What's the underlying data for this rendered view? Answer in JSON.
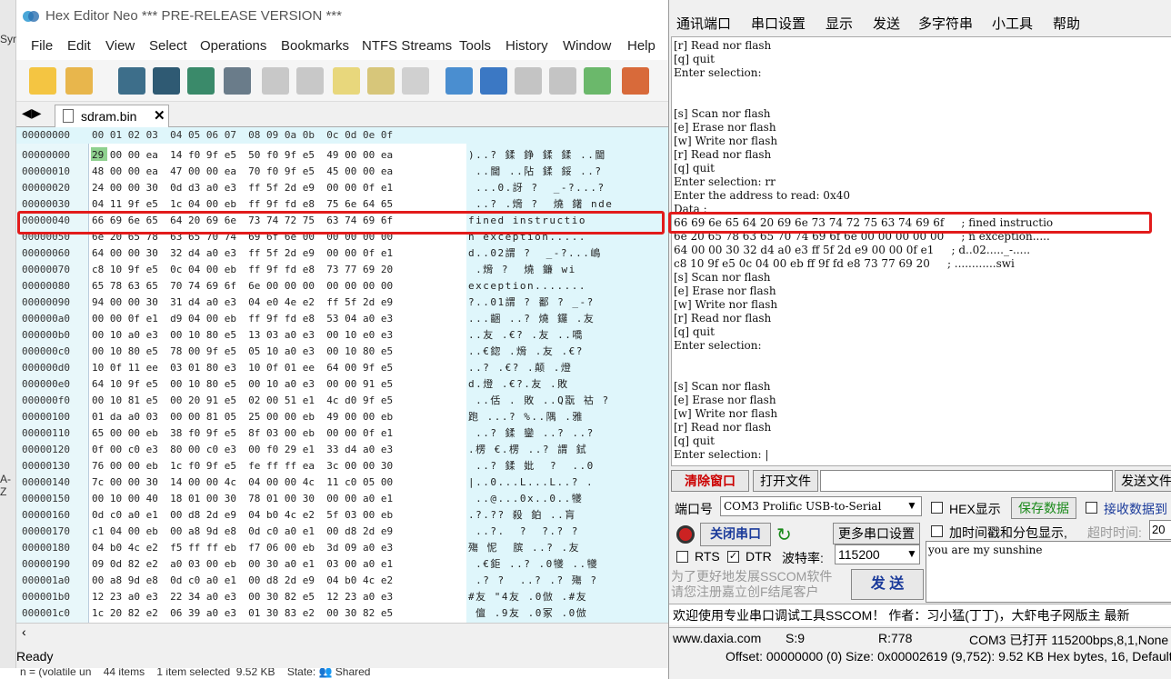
{
  "hex_editor": {
    "title": "Hex Editor Neo *** PRE-RELEASE VERSION ***",
    "menu": [
      "File",
      "Edit",
      "View",
      "Select",
      "Operations",
      "Bookmarks",
      "NTFS Streams",
      "Tools",
      "History",
      "Window",
      "Help"
    ],
    "tab": "sdram.bin",
    "header_offset": "00000000",
    "header_cols": "00 01 02 03  04 05 06 07  08 09 0a 0b  0c 0d 0e 0f",
    "rows": [
      {
        "off": "00000000",
        "hex": "29 00 00 ea  14 f0 9f e5  50 f0 9f e5  49 00 00 ea",
        "asc": ")..? 鍒 錚 鍒 鍒 ..閫"
      },
      {
        "off": "00000010",
        "hex": "48 00 00 ea  47 00 00 ea  70 f0 9f e5  45 00 00 ea",
        "asc": " ..閫 ..阽 鍒 鋖 ..?"
      },
      {
        "off": "00000020",
        "hex": "24 00 00 30  0d d3 a0 e3  ff 5f 2d e9  00 00 0f e1",
        "asc": " ...0.訝 ?  _-?...?"
      },
      {
        "off": "00000030",
        "hex": "04 11 9f e5  1c 04 00 eb  ff 9f fd e8  75 6e 64 65",
        "asc": " ..? .熁 ?  燒 鐯 nde"
      },
      {
        "off": "00000040",
        "hex": "66 69 6e 65  64 20 69 6e  73 74 72 75  63 74 69 6f",
        "asc": "fined instructio"
      },
      {
        "off": "00000050",
        "hex": "6e 20 65 78  63 65 70 74  69 6f 6e 00  00 00 00 00",
        "asc": "n exception....."
      },
      {
        "off": "00000060",
        "hex": "64 00 00 30  32 d4 a0 e3  ff 5f 2d e9  00 00 0f e1",
        "asc": "d..02謂 ?  _-?...嶋"
      },
      {
        "off": "00000070",
        "hex": "c8 10 9f e5  0c 04 00 eb  ff 9f fd e8  73 77 69 20",
        "asc": " .熁 ?  燒 鐮 wi"
      },
      {
        "off": "00000080",
        "hex": "65 78 63 65  70 74 69 6f  6e 00 00 00  00 00 00 00",
        "asc": "exception......."
      },
      {
        "off": "00000090",
        "hex": "94 00 00 30  31 d4 a0 e3  04 e0 4e e2  ff 5f 2d e9",
        "asc": "?..01謂 ? 鄱 ? _-?"
      },
      {
        "off": "000000a0",
        "hex": "00 00 0f e1  d9 04 00 eb  ff 9f fd e8  53 04 a0 e3",
        "asc": "...齫 ..? 燒 鑼 .友"
      },
      {
        "off": "000000b0",
        "hex": "00 10 a0 e3  00 10 80 e5  13 03 a0 e3  00 10 e0 e3",
        "asc": "..友 .€? .友 ..嘺"
      },
      {
        "off": "000000c0",
        "hex": "00 10 80 e5  78 00 9f e5  05 10 a0 e3  00 10 80 e5",
        "asc": "..€鍃 .熁 .友 .€?"
      },
      {
        "off": "000000d0",
        "hex": "10 0f 11 ee  03 01 80 e3  10 0f 01 ee  64 00 9f e5",
        "asc": "..? .€? .颠 .燈"
      },
      {
        "off": "000000e0",
        "hex": "64 10 9f e5  00 10 80 e5  00 10 a0 e3  00 00 91 e5",
        "asc": "d.燈 .€?.友 .敗"
      },
      {
        "off": "000000f0",
        "hex": "00 10 81 e5  00 20 91 e5  02 00 51 e1  4c d0 9f e5",
        "asc": " ..佸 . 敗 ..Q翫 祜 ?"
      },
      {
        "off": "00000100",
        "hex": "01 da a0 03  00 00 81 05  25 00 00 eb  49 00 00 eb",
        "asc": "跑 ...? %..隅 .雅"
      },
      {
        "off": "00000110",
        "hex": "65 00 00 eb  38 f0 9f e5  8f 03 00 eb  00 00 0f e1",
        "asc": " ..? 鍒 鑾 ..? ..?"
      },
      {
        "off": "00000120",
        "hex": "0f 00 c0 e3  80 00 c0 e3  00 f0 29 e1  33 d4 a0 e3",
        "asc": ".楞 €.楞 ..? 謂 鉽"
      },
      {
        "off": "00000130",
        "hex": "76 00 00 eb  1c f0 9f e5  fe ff ff ea  3c 00 00 30",
        "asc": " ..? 鍒 妣  ?  ..0"
      },
      {
        "off": "00000140",
        "hex": "7c 00 00 30  14 00 00 4c  04 00 00 4c  11 c0 05 00",
        "asc": "|..0...L...L..? ."
      },
      {
        "off": "00000150",
        "hex": "00 10 00 40  18 01 00 30  78 01 00 30  00 00 a0 e1",
        "asc": " ..@...0x..0..犪"
      },
      {
        "off": "00000160",
        "hex": "0d c0 a0 e1  00 d8 2d e9  04 b0 4c e2  5f 03 00 eb",
        "asc": ".?.?? 殺 鉑 ..肓"
      },
      {
        "off": "00000170",
        "hex": "c1 04 00 eb  00 a8 9d e8  0d c0 a0 e1  00 d8 2d e9",
        "asc": " ..?.  ?  ?.? ?"
      },
      {
        "off": "00000180",
        "hex": "04 b0 4c e2  f5 ff ff eb  f7 06 00 eb  3d 09 a0 e3",
        "asc": "殤 怩  膑 ..? .友"
      },
      {
        "off": "00000190",
        "hex": "09 0d 82 e2  a0 03 00 eb  00 30 a0 e1  03 00 a0 e1",
        "asc": " .€鉅 ..? .0犪 ..犪"
      },
      {
        "off": "000001a0",
        "hex": "00 a8 9d e8  0d c0 a0 e1  00 d8 2d e9  04 b0 4c e2",
        "asc": " .? ?  ..? .? 殤 ?"
      },
      {
        "off": "000001b0",
        "hex": "12 23 a0 e3  22 34 a0 e3  00 30 82 e5  12 23 a0 e3",
        "asc": "#友 \"4友 .0倣 .#友"
      },
      {
        "off": "000001c0",
        "hex": "1c 20 82 e2  06 39 a0 e3  01 30 83 e2  00 30 82 e5",
        "asc": " 儃 .9友 .0冢 .0倣"
      }
    ],
    "status": "Ready",
    "explorer": "n = (volatile un    44 items    1 item selected  9.52 KB    State: 👥 Shared"
  },
  "sscom": {
    "title_fragment": "串口调试工具 作者：习小猛(丁丁)",
    "menu": [
      "通讯端口",
      "串口设置",
      "显示",
      "发送",
      "多字符串",
      "小工具",
      "帮助"
    ],
    "console_lines": [
      "[r] Read nor flash",
      "[q] quit",
      "Enter selection:",
      "",
      "",
      "[s] Scan nor flash",
      "[e] Erase nor flash",
      "[w] Write nor flash",
      "[r] Read nor flash",
      "[q] quit",
      "Enter selection: rr",
      "Enter the address to read: 0x40",
      "Data :",
      "66 69 6e 65 64 20 69 6e 73 74 72 75 63 74 69 6f     ; fined instructio",
      "6e 20 65 78 63 65 70 74 69 6f 6e 00 00 00 00 00     ; n exception.....",
      "64 00 00 30 32 d4 a0 e3 ff 5f 2d e9 00 00 0f e1     ; d..02....._-.....",
      "c8 10 9f e5 0c 04 00 eb ff 9f fd e8 73 77 69 20     ; ............swi",
      "[s] Scan nor flash",
      "[e] Erase nor flash",
      "[w] Write nor flash",
      "[r] Read nor flash",
      "[q] quit",
      "Enter selection:",
      "",
      "",
      "[s] Scan nor flash",
      "[e] Erase nor flash",
      "[w] Write nor flash",
      "[r] Read nor flash",
      "[q] quit",
      "Enter selection: |"
    ],
    "clear_btn": "清除窗口",
    "open_file_btn": "打开文件",
    "send_file_btn": "发送文件",
    "port_label": "端口号",
    "port_value": "COM3 Prolific USB-to-Serial",
    "hex_show": "HEX显示",
    "save_data": "保存数据",
    "recv_to": "接收数据到",
    "close_port": "关闭串口",
    "more_settings": "更多串口设置",
    "timestamp": "加时间戳和分包显示,",
    "timeout_label": "超时时间:",
    "timeout_value": "20",
    "rts": "RTS",
    "dtr": "DTR",
    "baud_label": "波特率:",
    "baud_value": "115200",
    "send_text": "you are my sunshine",
    "promo": "为了更好地发展SSCOM软件\n请您注册嘉立创F结尾客户",
    "send_btn": "发 送",
    "welcome": "欢迎使用专业串口调试工具SSCOM！  作者：习小猛(丁丁)，大虾电子网版主  最新",
    "status_site": "www.daxia.com",
    "status_s": "S:9",
    "status_r": "R:778",
    "status_port": "COM3 已打开  115200bps,8,1,None",
    "offset_bar": "Offset: 00000000 (0)  Size: 0x00002619 (9,752): 9.52 KB  Hex bytes, 16, Default"
  },
  "colors": {
    "highlight": "#e21b1b",
    "hexbg": "#dff6fb",
    "accent": "#8fd18f"
  }
}
